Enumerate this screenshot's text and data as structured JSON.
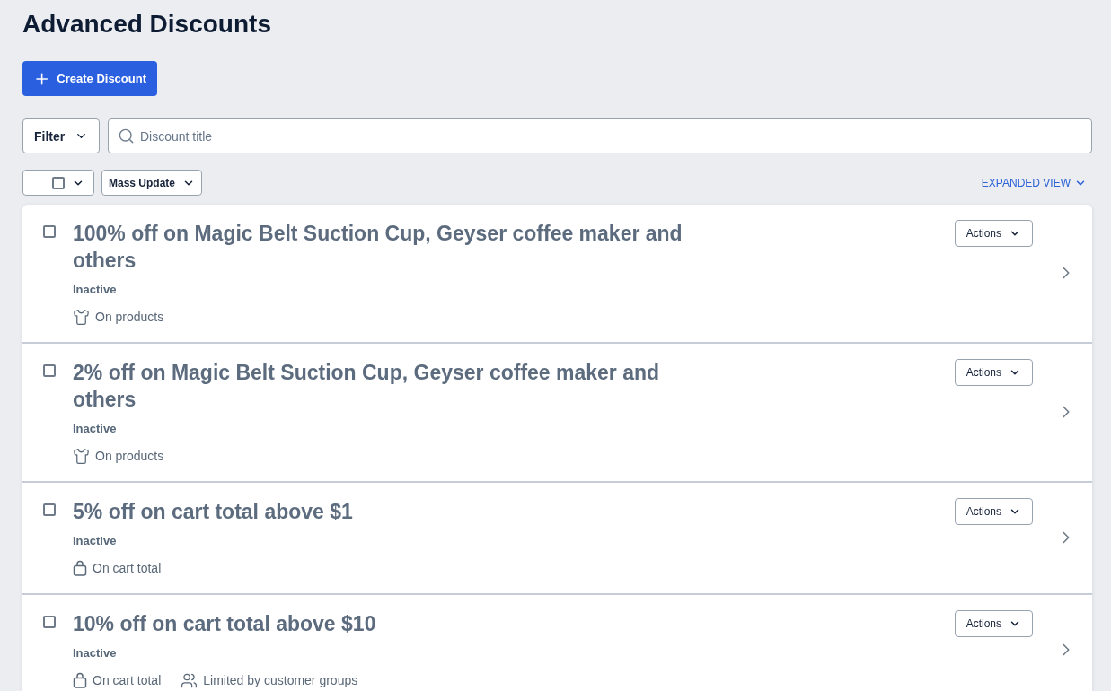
{
  "page": {
    "title": "Advanced Discounts"
  },
  "create_button": {
    "label": "Create Discount"
  },
  "toolbar": {
    "filter": {
      "label": "Filter"
    },
    "search": {
      "placeholder": "Discount title"
    }
  },
  "bulk_bar": {
    "select_all": {
      "checked": false
    },
    "mass_update": {
      "label": "Mass Update"
    },
    "view_toggle": {
      "label": "EXPANDED VIEW"
    }
  },
  "discounts": [
    {
      "title": "100% off on Magic Belt Suction Cup, Geyser coffee maker and others",
      "checked": false,
      "status": "Inactive",
      "conditions": [
        {
          "kind": "products",
          "label": "On products"
        }
      ],
      "actions": "Actions"
    },
    {
      "title": "2% off on Magic Belt Suction Cup, Geyser coffee maker and others",
      "checked": false,
      "status": "Inactive",
      "conditions": [
        {
          "kind": "products",
          "label": "On products"
        }
      ],
      "actions": "Actions"
    },
    {
      "title": "5% off on cart total above $1",
      "checked": false,
      "status": "Inactive",
      "conditions": [
        {
          "kind": "cart_total",
          "label": "On cart total"
        }
      ],
      "actions": "Actions"
    },
    {
      "title": "10% off on cart total above $10",
      "checked": false,
      "status": "Inactive",
      "conditions": [
        {
          "kind": "cart_total",
          "label": "On cart total"
        },
        {
          "kind": "customer_groups",
          "label": "Limited by customer groups"
        }
      ],
      "actions": "Actions"
    }
  ]
}
